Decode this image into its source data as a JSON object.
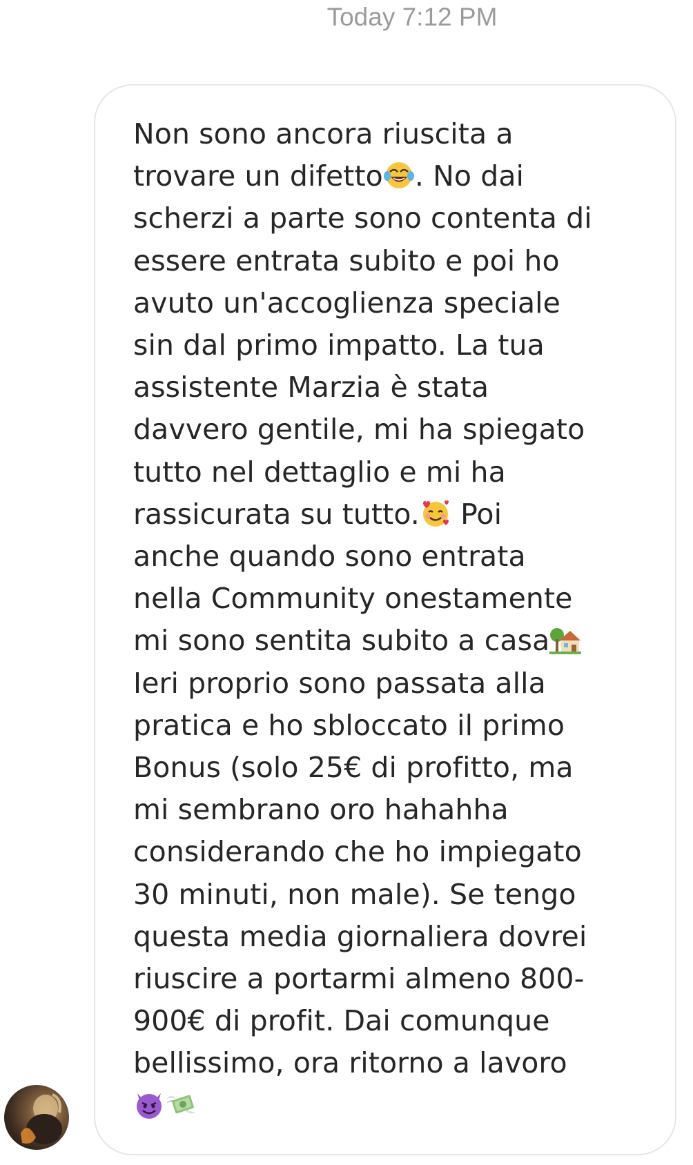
{
  "thread": {
    "timestamp": "Today 7:12 PM"
  },
  "message": {
    "lines": [
      "Non sono ancora riuscita a",
      "trovare un difetto",
      ". No dai",
      "scherzi a parte sono contenta di",
      "essere entrata subito e poi ho",
      "avuto un'accoglienza speciale",
      "sin dal primo impatto. La tua",
      "assistente Marzia è stata",
      "davvero gentile, mi ha spiegato",
      "tutto nel dettaglio e mi ha",
      "rassicurata su tutto.",
      " Poi",
      "anche quando sono entrata",
      "nella Community onestamente",
      "mi sono sentita subito a casa",
      "Ieri proprio sono passata alla",
      "pratica e ho sbloccato il primo",
      "Bonus (solo 25€ di profitto, ma",
      "mi sembrano oro hahahha",
      "considerando che ho impiegato",
      "30 minuti, non male). Se tengo",
      "questa media giornaliera dovrei",
      "riuscire a portarmi almeno 800-",
      "900€ di profit. Dai comunque",
      "bellissimo, ora ritorno a lavoro"
    ],
    "emojis": {
      "laughing": "face-with-tears-of-joy-icon",
      "hearts": "smiling-face-with-hearts-icon",
      "house": "house-with-garden-icon",
      "devil": "smiling-face-with-horns-icon",
      "money": "money-with-wings-icon"
    }
  },
  "colors": {
    "text": "#262626",
    "timestamp": "#9b9b9b",
    "bubble_border": "#e6e6e6"
  }
}
